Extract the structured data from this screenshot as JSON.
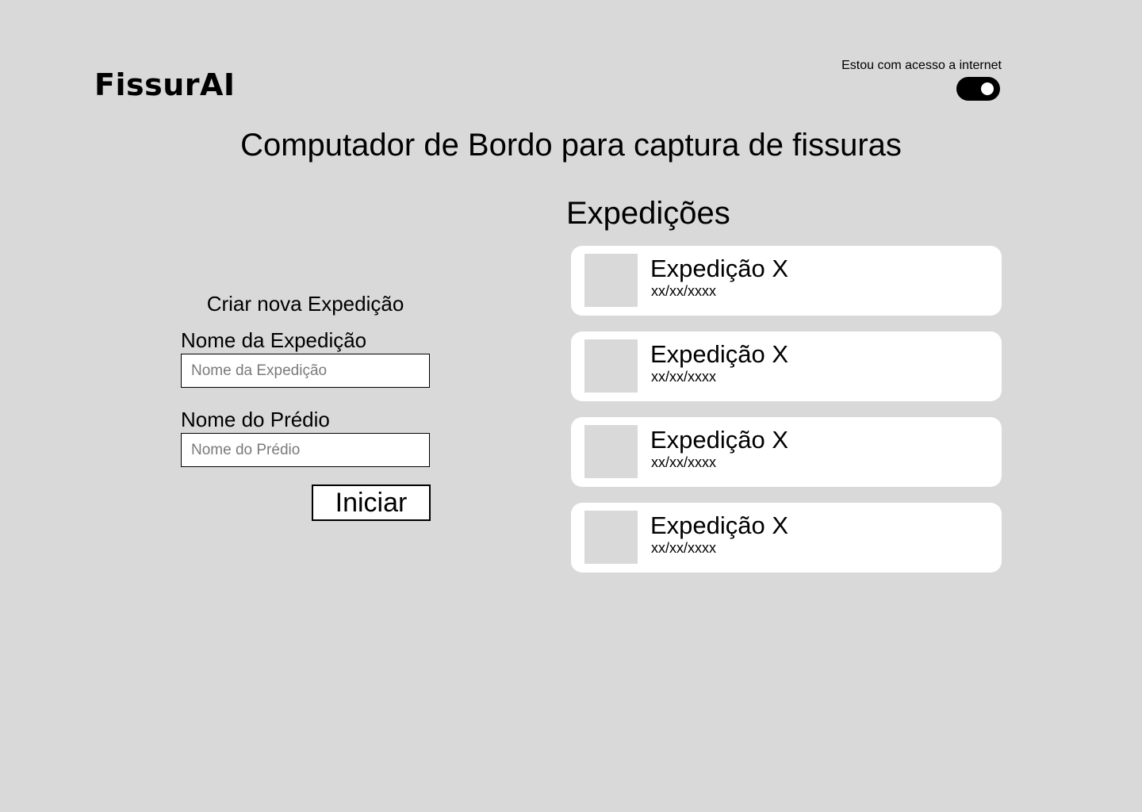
{
  "header": {
    "logo_text": "FissurAI",
    "internet_label": "Estou com acesso a internet",
    "internet_toggle_on": true
  },
  "page_title": "Computador de Bordo para captura de fissuras",
  "form": {
    "title": "Criar nova Expedição",
    "expedition_name": {
      "label": "Nome da Expedição",
      "placeholder": "Nome da Expedição",
      "value": ""
    },
    "building_name": {
      "label": "Nome do Prédio",
      "placeholder": "Nome do Prédio",
      "value": ""
    },
    "start_label": "Iniciar"
  },
  "expeditions": {
    "title": "Expedições",
    "items": [
      {
        "name": "Expedição X",
        "date": "xx/xx/xxxx"
      },
      {
        "name": "Expedição X",
        "date": "xx/xx/xxxx"
      },
      {
        "name": "Expedição X",
        "date": "xx/xx/xxxx"
      },
      {
        "name": "Expedição X",
        "date": "xx/xx/xxxx"
      }
    ]
  },
  "colors": {
    "background": "#d9d9d9",
    "card": "#ffffff",
    "toggle": "#000000"
  }
}
